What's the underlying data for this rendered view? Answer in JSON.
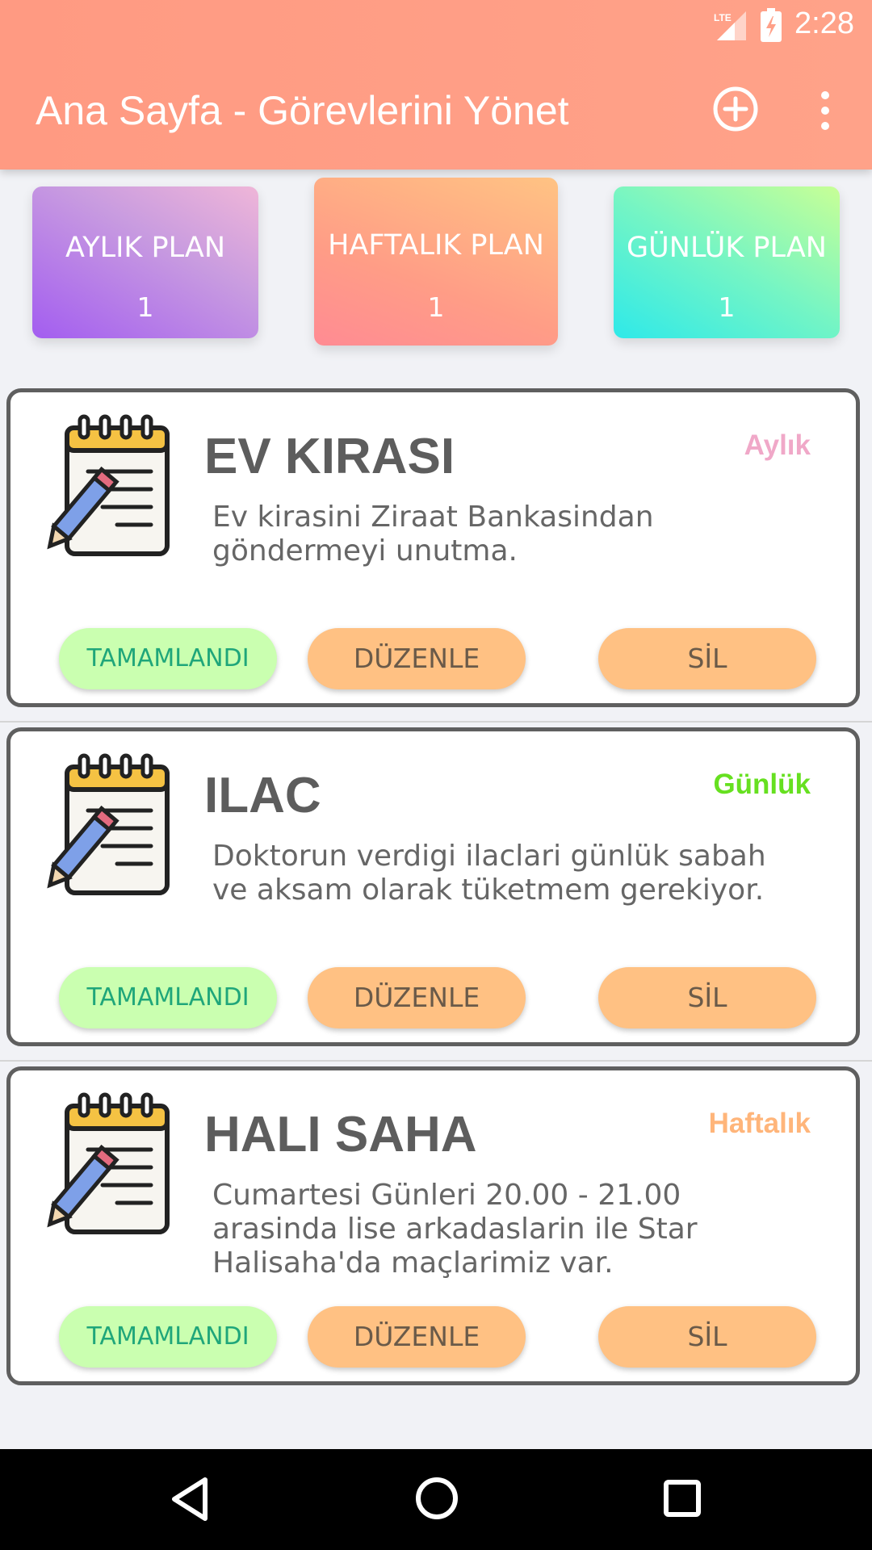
{
  "status_bar": {
    "time": "2:28",
    "network": "LTE",
    "icons": [
      "lte-signal-icon",
      "battery-charging-icon"
    ]
  },
  "app_bar": {
    "title": "Ana Sayfa - Görevlerini Yönet",
    "actions": [
      "add-circle-icon",
      "more-vert-icon"
    ]
  },
  "plans": [
    {
      "label": "AYLIK PLAN",
      "count": "1"
    },
    {
      "label": "HAFTALIK PLAN",
      "count": "1"
    },
    {
      "label": "GÜNLÜK PLAN",
      "count": "1"
    }
  ],
  "tasks": [
    {
      "title": "EV KIRASI",
      "type": "Aylık",
      "type_color": "#f0a8c8",
      "description": "Ev kirasini Ziraat Bankasindan\ngöndermeyi unutma.",
      "buttons": {
        "done": "TAMAMLANDI",
        "edit": "DÜZENLE",
        "delete": "SİL"
      }
    },
    {
      "title": "ILAC",
      "type": "Günlük",
      "type_color": "#66e020",
      "description": "Doktorun verdigi ilaclari günlük sabah\nve aksam olarak tüketmem gerekiyor.",
      "buttons": {
        "done": "TAMAMLANDI",
        "edit": "DÜZENLE",
        "delete": "SİL"
      }
    },
    {
      "title": "HALI SAHA",
      "type": "Haftalık",
      "type_color": "#ffb57a",
      "description": "Cumartesi Günleri 20.00 - 21.00\narasinda lise arkadaslarin ile Star\nHalisaha'da maçlarimiz var.",
      "buttons": {
        "done": "TAMAMLANDI",
        "edit": "DÜZENLE",
        "delete": "SİL"
      }
    }
  ],
  "navigation": [
    "back-icon",
    "home-icon",
    "recent-apps-icon"
  ],
  "colors": {
    "app_bar": "#ffa088",
    "done_button": "#caffb0",
    "action_button": "#ffc183"
  }
}
